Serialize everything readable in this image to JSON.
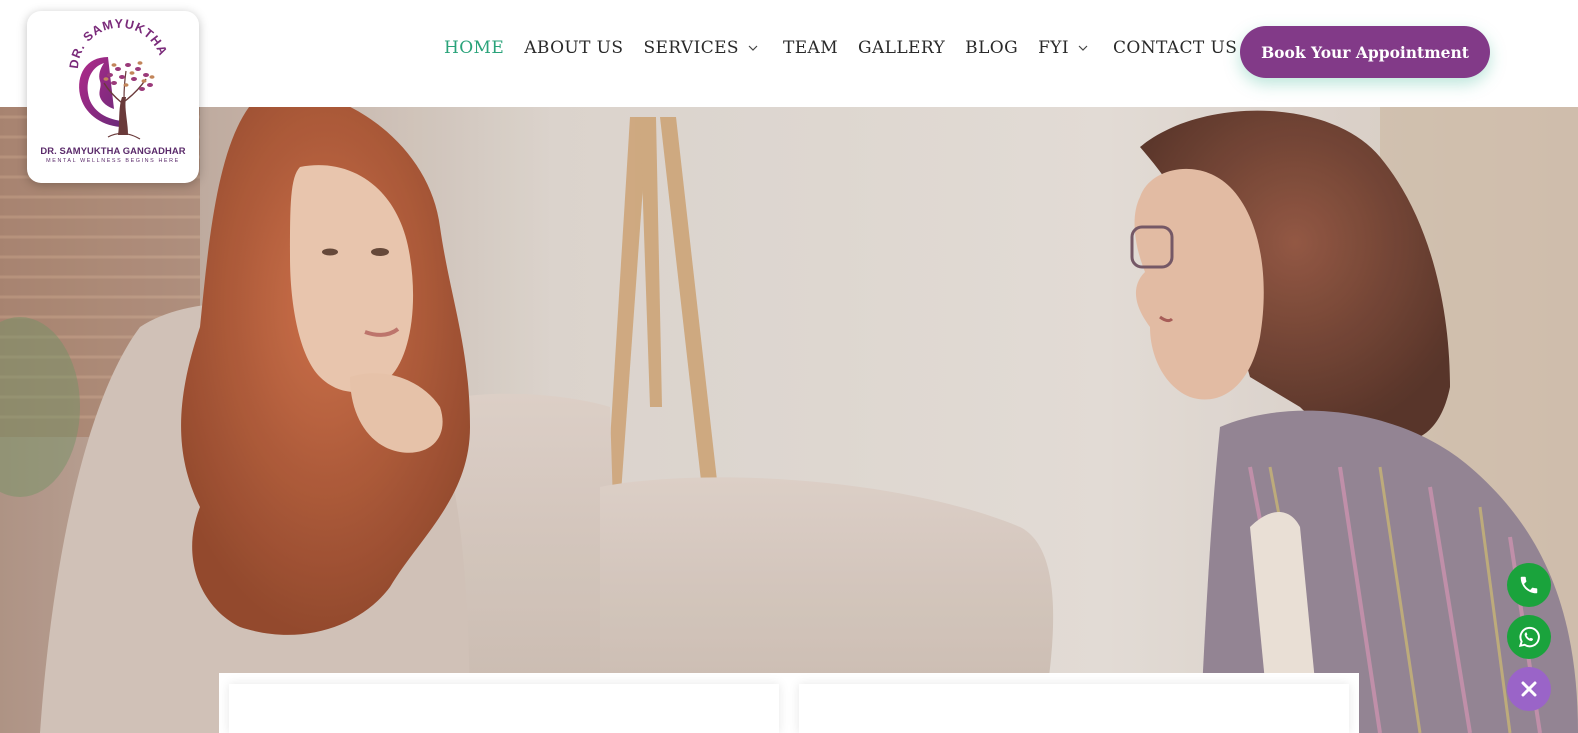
{
  "brand": {
    "arc_text": "DR. SAMYUKTHA",
    "name": "DR. SAMYUKTHA GANGADHAR",
    "tagline": "MENTAL WELLNESS BEGINS HERE",
    "primary_color": "#823a88",
    "accent_color": "#2aa37a"
  },
  "nav": {
    "items": [
      {
        "label": "HOME",
        "active": true,
        "has_dropdown": false
      },
      {
        "label": "ABOUT US",
        "active": false,
        "has_dropdown": false
      },
      {
        "label": "SERVICES",
        "active": false,
        "has_dropdown": true
      },
      {
        "label": "TEAM",
        "active": false,
        "has_dropdown": false
      },
      {
        "label": "GALLERY",
        "active": false,
        "has_dropdown": false
      },
      {
        "label": "BLOG",
        "active": false,
        "has_dropdown": false
      },
      {
        "label": "FYI",
        "active": false,
        "has_dropdown": true
      },
      {
        "label": "CONTACT US",
        "active": false,
        "has_dropdown": false
      }
    ],
    "cta_label": "Book Your Appointment"
  },
  "hero": {
    "image_description_icon": "counseling-session-photo"
  },
  "floating_actions": [
    {
      "icon": "phone-icon",
      "color": "#1aa33c"
    },
    {
      "icon": "whatsapp-icon",
      "color": "#1aa33c"
    },
    {
      "icon": "close-icon",
      "color": "#9a64c8"
    }
  ]
}
